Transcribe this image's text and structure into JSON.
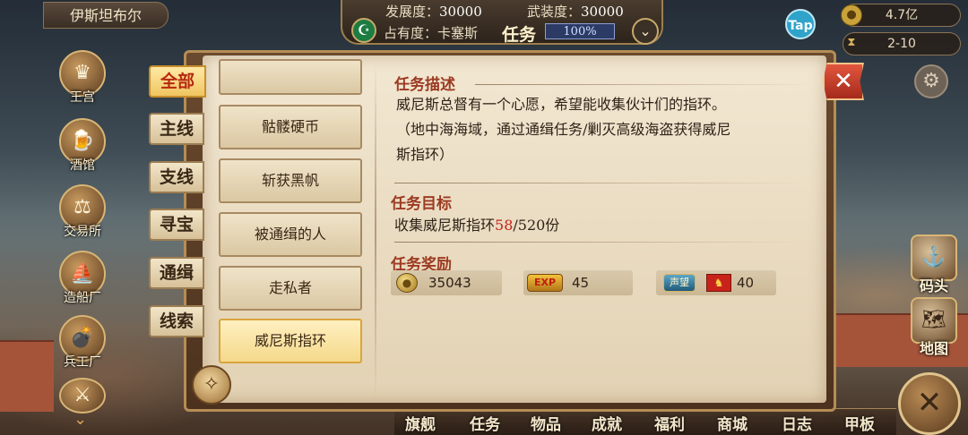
{
  "city": "伊斯坦布尔",
  "topbar": {
    "development_label": "发展度：",
    "development_value": "30000",
    "armament_label": "武装度：",
    "armament_value": "30000",
    "occupancy_label": "占有度：卡塞斯",
    "occupancy_value": "100%",
    "title": "任务"
  },
  "resources": {
    "gold": "4.7亿",
    "time": "2-10",
    "tap": "Tap"
  },
  "sidebar_left": [
    "王宫",
    "酒馆",
    "交易所",
    "造船厂",
    "兵工厂"
  ],
  "sidebar_right": [
    "码头",
    "地图"
  ],
  "bottom_nav": [
    "旗舰",
    "任务",
    "物品",
    "成就",
    "福利",
    "商城",
    "日志",
    "甲板"
  ],
  "categories": [
    "全部",
    "主线",
    "支线",
    "寻宝",
    "通缉",
    "线索"
  ],
  "active_category": "全部",
  "quests": [
    "骷髅硬币",
    "斩获黑帆",
    "被通缉的人",
    "走私者",
    "威尼斯指环"
  ],
  "active_quest": "威尼斯指环",
  "detail": {
    "desc_title": "任务描述",
    "desc_line1": "威尼斯总督有一个心愿，希望能收集伙计们的指环。",
    "desc_line2": "（地中海海域，通过通缉任务/剿灭高级海盗获得威尼",
    "desc_line3": "斯指环）",
    "goal_title": "任务目标",
    "goal_prefix": "收集威尼斯指环",
    "goal_current": "58",
    "goal_suffix": "/520份",
    "reward_title": "任务奖励",
    "reward_gold": "35043",
    "reward_exp_label": "EXP",
    "reward_exp": "45",
    "reward_rep_label": "声望",
    "reward_rep": "40"
  },
  "icons": {
    "close": "close-icon",
    "compass": "compass-icon",
    "gear": "gear-icon",
    "crescent": "crescent-flag-icon"
  },
  "colors": {
    "accent_red": "#c6221b",
    "section_title": "#9c3a22",
    "paper": "#f2e7d2"
  }
}
